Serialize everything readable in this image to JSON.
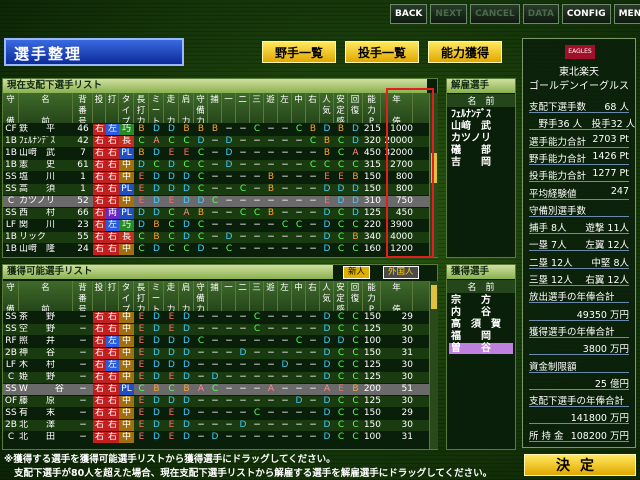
{
  "toolbar": {
    "back": "BACK",
    "next": "NEXT",
    "cancel": "CANCEL",
    "data": "DATA",
    "config": "CONFIG",
    "menu": "MENU"
  },
  "title": "選手整理",
  "tabs": {
    "fielders": "野手一覧",
    "pitchers": "投手一覧",
    "ability": "能力獲得"
  },
  "current_list": {
    "header": "現在支配下選手リスト",
    "columns": [
      "守\n\n備",
      "名\n\n前",
      "背\n番\n号",
      "投\n",
      "打\n",
      "タ\nイ\nプ",
      "長\n打\n力",
      "ミ\nー\nト",
      "走\n\n力",
      "肩\n\n力",
      "守\n備\n力",
      "捕\n",
      "一\n",
      "二\n",
      "三\n",
      "遊\n",
      "左\n",
      "中\n",
      "右\n",
      "人\n気",
      "安\n定\n感",
      "回\n復",
      "能\n力\nP",
      "年\n\n俸"
    ],
    "rows": [
      {
        "pos": "CF",
        "name": "鉄　　平",
        "num": "46",
        "t": "右",
        "b": "左",
        "type": "巧",
        "v": [
          "B",
          "D",
          "D",
          "B",
          "B",
          "B",
          "−",
          "−",
          "C",
          "−",
          "−",
          "C",
          "B",
          "D",
          "B",
          "D"
        ],
        "p": "215",
        "sal": "1000"
      },
      {
        "pos": "1B",
        "name": "ﾌｪﾙﾅﾝﾃﾞｽ",
        "num": "42",
        "t": "右",
        "b": "右",
        "type": "長",
        "v": [
          "C",
          "A",
          "C",
          "C",
          "D",
          "−",
          "D",
          "−",
          "−",
          "−",
          "−",
          "−",
          "C",
          "B",
          "C",
          "D"
        ],
        "p": "320",
        "sal": "20000"
      },
      {
        "pos": "1B",
        "name": "山﨑　武",
        "num": "7",
        "t": "右",
        "b": "右",
        "type": "PL",
        "v": [
          "B",
          "D",
          "E",
          "E",
          "C",
          "−",
          "D",
          "−",
          "−",
          "−",
          "−",
          "−",
          "−",
          "B",
          "C",
          "A"
        ],
        "p": "450",
        "sal": "32000"
      },
      {
        "pos": "1B",
        "name": "憲　　史",
        "num": "61",
        "t": "右",
        "b": "右",
        "type": "中",
        "v": [
          "D",
          "C",
          "D",
          "C",
          "C",
          "−",
          "D",
          "−",
          "−",
          "−",
          "−",
          "−",
          "C",
          "C",
          "C",
          "C"
        ],
        "p": "315",
        "sal": "2700"
      },
      {
        "pos": "SS",
        "name": "塩　　川",
        "num": "1",
        "t": "右",
        "b": "右",
        "type": "中",
        "v": [
          "E",
          "D",
          "D",
          "D",
          "C",
          "−",
          "−",
          "−",
          "−",
          "B",
          "−",
          "−",
          "−",
          "E",
          "E",
          "B"
        ],
        "p": "150",
        "sal": "800"
      },
      {
        "pos": "SS",
        "name": "高　　須",
        "num": "1",
        "t": "右",
        "b": "右",
        "type": "PL",
        "v": [
          "E",
          "D",
          "D",
          "D",
          "C",
          "−",
          "−",
          "C",
          "−",
          "B",
          "−",
          "−",
          "−",
          "D",
          "D",
          "D"
        ],
        "p": "150",
        "sal": "800"
      },
      {
        "pos": "C",
        "name": "カツノリ",
        "num": "52",
        "t": "右",
        "b": "右",
        "type": "中",
        "v": [
          "E",
          "D",
          "E",
          "D",
          "D",
          "C",
          "−",
          "−",
          "−",
          "−",
          "−",
          "−",
          "−",
          "E",
          "D",
          "D"
        ],
        "p": "310",
        "sal": "750"
      },
      {
        "pos": "SS",
        "name": "西　　村",
        "num": "66",
        "t": "右",
        "b": "両",
        "type": "PL",
        "v": [
          "D",
          "D",
          "C",
          "A",
          "B",
          "−",
          "−",
          "C",
          "C",
          "B",
          "−",
          "−",
          "−",
          "D",
          "C",
          "D"
        ],
        "p": "125",
        "sal": "450"
      },
      {
        "pos": "LF",
        "name": "関　　川",
        "num": "23",
        "t": "右",
        "b": "左",
        "type": "巧",
        "v": [
          "D",
          "B",
          "C",
          "D",
          "C",
          "−",
          "−",
          "−",
          "−",
          "−",
          "C",
          "C",
          "−",
          "D",
          "C",
          "C"
        ],
        "p": "220",
        "sal": "3900"
      },
      {
        "pos": "1B",
        "name": "リック",
        "num": "55",
        "t": "右",
        "b": "右",
        "type": "長",
        "v": [
          "C",
          "B",
          "C",
          "D",
          "C",
          "−",
          "D",
          "−",
          "−",
          "−",
          "−",
          "−",
          "−",
          "D",
          "C",
          "B"
        ],
        "p": "340",
        "sal": "4000"
      },
      {
        "pos": "1B",
        "name": "山﨑　隆",
        "num": "24",
        "t": "右",
        "b": "右",
        "type": "中",
        "v": [
          "C",
          "D",
          "C",
          "C",
          "D",
          "−",
          "C",
          "−",
          "−",
          "−",
          "−",
          "−",
          "−",
          "D",
          "C",
          "C"
        ],
        "p": "160",
        "sal": "1200"
      }
    ]
  },
  "acquire_list": {
    "header": "獲得可能選手リスト",
    "btn_new": "新人",
    "btn_foreign": "外国人",
    "columns": [
      "守\n\n備",
      "名\n\n前",
      "背\n番\n号",
      "投\n",
      "打\n",
      "タ\nイ\nプ",
      "長\n打\n力",
      "ミ\nー\nト",
      "走\n\n力",
      "肩\n\n力",
      "守\n備\n力",
      "捕\n",
      "一\n",
      "二\n",
      "三\n",
      "遊\n",
      "左\n",
      "中\n",
      "右\n",
      "人\n気",
      "安\n定\n感",
      "回\n復",
      "能\n力\nP",
      "年\n\n俸\n万\n円"
    ],
    "rows": [
      {
        "pos": "SS",
        "name": "茶　　野",
        "num": "−",
        "t": "右",
        "b": "右",
        "type": "中",
        "v": [
          "E",
          "D",
          "E",
          "D",
          "−",
          "−",
          "−",
          "−",
          "C",
          "−",
          "−",
          "−",
          "−",
          "D",
          "C",
          "C"
        ],
        "p": "150",
        "sal": "29"
      },
      {
        "pos": "SS",
        "name": "空　　野",
        "num": "−",
        "t": "右",
        "b": "右",
        "type": "中",
        "v": [
          "E",
          "D",
          "E",
          "D",
          "−",
          "−",
          "−",
          "−",
          "C",
          "−",
          "−",
          "−",
          "−",
          "D",
          "C",
          "C"
        ],
        "p": "125",
        "sal": "30"
      },
      {
        "pos": "RF",
        "name": "照　　井",
        "num": "−",
        "t": "右",
        "b": "左",
        "type": "中",
        "v": [
          "E",
          "D",
          "D",
          "D",
          "C",
          "−",
          "−",
          "−",
          "−",
          "−",
          "−",
          "C",
          "−",
          "D",
          "D",
          "C"
        ],
        "p": "100",
        "sal": "30"
      },
      {
        "pos": "2B",
        "name": "神　　谷",
        "num": "−",
        "t": "右",
        "b": "右",
        "type": "中",
        "v": [
          "E",
          "D",
          "D",
          "D",
          "−",
          "−",
          "−",
          "D",
          "−",
          "−",
          "−",
          "−",
          "−",
          "D",
          "C",
          "C"
        ],
        "p": "150",
        "sal": "31"
      },
      {
        "pos": "LF",
        "name": "木　　村",
        "num": "−",
        "t": "右",
        "b": "左",
        "type": "中",
        "v": [
          "E",
          "D",
          "D",
          "D",
          "−",
          "−",
          "−",
          "−",
          "−",
          "−",
          "D",
          "−",
          "−",
          "D",
          "C",
          "C"
        ],
        "p": "125",
        "sal": "30"
      },
      {
        "pos": "C",
        "name": "姫　　野",
        "num": "−",
        "t": "右",
        "b": "右",
        "type": "中",
        "v": [
          "E",
          "D",
          "E",
          "D",
          "−",
          "D",
          "−",
          "−",
          "−",
          "−",
          "−",
          "−",
          "−",
          "D",
          "C",
          "C"
        ],
        "p": "125",
        "sal": "30"
      },
      {
        "pos": "SS",
        "name": "W　　　谷",
        "num": "−",
        "t": "右",
        "b": "右",
        "type": "PL",
        "v": [
          "C",
          "B",
          "C",
          "B",
          "A",
          "C",
          "−",
          "−",
          "−",
          "A",
          "−",
          "−",
          "−",
          "A",
          "E",
          "B"
        ],
        "p": "200",
        "sal": "51"
      },
      {
        "pos": "OF",
        "name": "藤　　原",
        "num": "−",
        "t": "右",
        "b": "右",
        "type": "中",
        "v": [
          "E",
          "D",
          "D",
          "D",
          "−",
          "−",
          "−",
          "−",
          "−",
          "−",
          "−",
          "D",
          "−",
          "D",
          "C",
          "C"
        ],
        "p": "125",
        "sal": "30"
      },
      {
        "pos": "SS",
        "name": "有　　末",
        "num": "−",
        "t": "右",
        "b": "右",
        "type": "中",
        "v": [
          "E",
          "D",
          "E",
          "D",
          "−",
          "−",
          "−",
          "−",
          "C",
          "−",
          "−",
          "−",
          "−",
          "D",
          "C",
          "C"
        ],
        "p": "150",
        "sal": "29"
      },
      {
        "pos": "2B",
        "name": "北　　澤",
        "num": "−",
        "t": "右",
        "b": "右",
        "type": "中",
        "v": [
          "E",
          "D",
          "E",
          "D",
          "−",
          "−",
          "−",
          "D",
          "−",
          "−",
          "−",
          "−",
          "−",
          "D",
          "C",
          "C"
        ],
        "p": "150",
        "sal": "30"
      },
      {
        "pos": "C",
        "name": "北　　田",
        "num": "−",
        "t": "右",
        "b": "右",
        "type": "中",
        "v": [
          "E",
          "D",
          "E",
          "D",
          "−",
          "D",
          "−",
          "−",
          "−",
          "−",
          "−",
          "−",
          "−",
          "D",
          "C",
          "C"
        ],
        "p": "100",
        "sal": "31"
      }
    ]
  },
  "release_list": {
    "header": "解雇選手",
    "col_name": "名　前",
    "items": [
      {
        "name": "ﾌｪﾙﾅﾝﾃﾞｽ"
      },
      {
        "name": "山﨑　武"
      },
      {
        "name": "カツノリ"
      },
      {
        "name": "礒　　部"
      },
      {
        "name": "吉　　岡"
      }
    ]
  },
  "acquired_list": {
    "header": "獲得選手",
    "col_name": "名　前",
    "items": [
      {
        "name": "宗　　方"
      },
      {
        "name": "内　　谷"
      },
      {
        "name": "高　須　賀"
      },
      {
        "name": "福　　岡"
      },
      {
        "name": "曽　　谷"
      }
    ]
  },
  "team": {
    "logo": "EAGLES",
    "name_line1": "東北楽天",
    "name_line2": "ゴールデンイーグルス",
    "stats": [
      {
        "l": "支配下選手数",
        "r": "68 人"
      },
      {
        "l": "　野手36 人　投手32 人",
        "r": ""
      },
      {
        "l": "選手能力合計",
        "r": "2703 Pt"
      },
      {
        "l": "野手能力合計",
        "r": "1426 Pt"
      },
      {
        "l": "投手能力合計",
        "r": "1277 Pt"
      },
      {
        "l": "平均経験値",
        "r": "247"
      },
      {
        "l": "守備別選手数",
        "r": ""
      },
      {
        "l": "捕手 8人",
        "r": "遊撃 11人"
      },
      {
        "l": "一塁 7人",
        "r": "左翼 12人"
      },
      {
        "l": "二塁 12人",
        "r": "中堅 8人"
      },
      {
        "l": "三塁 12人",
        "r": "右翼 12人"
      },
      {
        "l": "放出選手の年俸合計",
        "r": ""
      },
      {
        "l": "",
        "r": "49350 万円"
      },
      {
        "l": "獲得選手の年俸合計",
        "r": ""
      },
      {
        "l": "",
        "r": "3800 万円"
      },
      {
        "l": "資金制限額",
        "r": ""
      },
      {
        "l": "",
        "r": "25 億円"
      },
      {
        "l": "支配下選手の年俸合計",
        "r": ""
      },
      {
        "l": "",
        "r": "141800 万円"
      },
      {
        "l": "所 持 金",
        "r": "108200 万円"
      }
    ]
  },
  "footer": {
    "line1": "※獲得する選手を獲得可能選手リストから獲得選手にドラッグしてください。",
    "line2": "支配下選手が80人を超えた場合、現在支配下選手リストから解雇する選手を解雇選手にドラッグしてください。"
  },
  "decide": "決定"
}
